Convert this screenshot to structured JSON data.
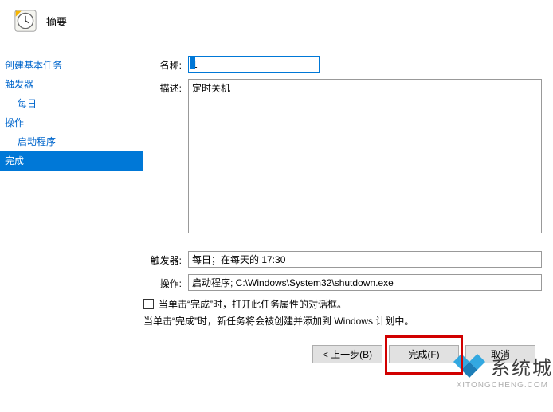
{
  "header": {
    "title": "摘要"
  },
  "sidebar": {
    "items": [
      {
        "label": "创建基本任务",
        "indent": false,
        "selected": false
      },
      {
        "label": "触发器",
        "indent": false,
        "selected": false
      },
      {
        "label": "每日",
        "indent": true,
        "selected": false
      },
      {
        "label": "操作",
        "indent": false,
        "selected": false
      },
      {
        "label": "启动程序",
        "indent": true,
        "selected": false
      },
      {
        "label": "完成",
        "indent": false,
        "selected": true
      }
    ]
  },
  "form": {
    "name_label": "名称:",
    "name_value": "1",
    "desc_label": "描述:",
    "desc_value": "定时关机",
    "trigger_label": "触发器:",
    "trigger_value": "每日；在每天的 17:30",
    "action_label": "操作:",
    "action_value": "启动程序; C:\\Windows\\System32\\shutdown.exe",
    "checkbox_label": "当单击“完成”时，打开此任务属性的对话框。",
    "info_text": "当单击“完成”时，新任务将会被创建并添加到 Windows 计划中。"
  },
  "buttons": {
    "back": "< 上一步(B)",
    "finish": "完成(F)",
    "cancel": "取消"
  },
  "watermark": {
    "text": "系统城",
    "sub": "XITONGCHENG.COM"
  }
}
